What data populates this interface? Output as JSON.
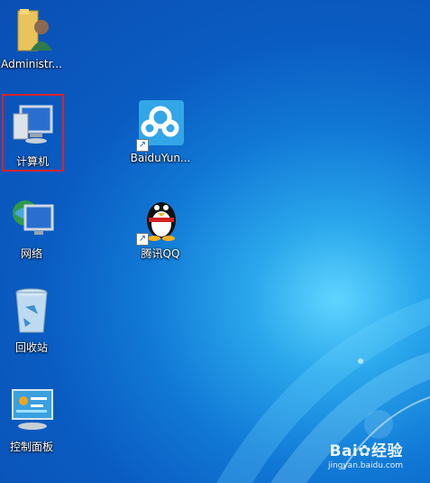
{
  "desktop": {
    "icons": [
      {
        "label": "Administr..."
      },
      {
        "label": "计算机"
      },
      {
        "label": "BaiduYun..."
      },
      {
        "label": "网络"
      },
      {
        "label": "腾讯QQ"
      },
      {
        "label": "回收站"
      },
      {
        "label": "控制面板"
      }
    ]
  },
  "watermark": {
    "brand": "Bai",
    "brand_rest": "经验",
    "url": "jingyan.baidu.com"
  },
  "colors": {
    "selection_border": "#d8242c",
    "desktop_blue": "#0a5cc2"
  }
}
